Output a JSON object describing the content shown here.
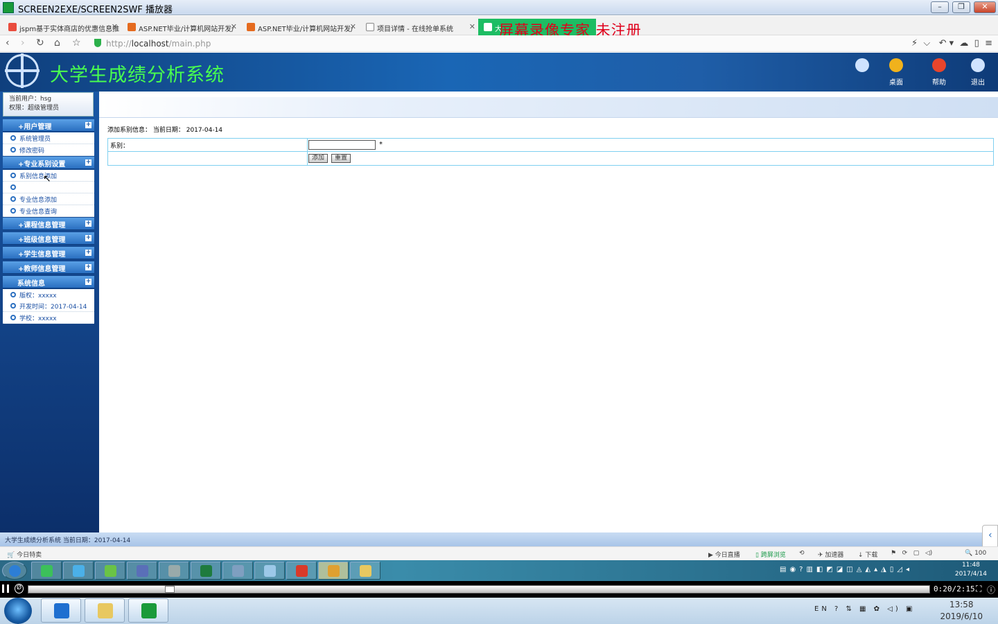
{
  "window": {
    "title": "SCREEN2EXE/SCREEN2SWF 播放器"
  },
  "tabs": [
    {
      "label": "jspm基于实体商店的优惠信息推",
      "color": "#e94c3d"
    },
    {
      "label": "ASP.NET毕业/计算机网站开发/",
      "color": "#e56b1f"
    },
    {
      "label": "ASP.NET毕业/计算机网站开发/",
      "color": "#e56b1f"
    },
    {
      "label": "项目详情 - 在线抢单系统",
      "color": "#888888"
    },
    {
      "label": "大",
      "color": "#ffffff"
    }
  ],
  "watermark": "屏幕录像专家   未注册",
  "address": {
    "scheme": "http://",
    "host": "localhost",
    "path": "/main.php"
  },
  "app": {
    "title": "大学生成绩分析系统",
    "header_buttons": [
      {
        "label": "",
        "color": "#cfe3ff"
      },
      {
        "label": "桌面",
        "color": "#f0b21c"
      },
      {
        "label": "帮助",
        "color": "#e8452c"
      },
      {
        "label": "退出",
        "color": "#cfe3ff"
      }
    ]
  },
  "user": {
    "current": "当前用户：hsg",
    "role": "权限：超级管理员"
  },
  "menu": {
    "user_mgmt": "+用户管理",
    "sys_admin": "系统管理员",
    "change_pwd": "修改密码",
    "dept_settings": "+专业系别设置",
    "dept_add": "系别信息添加",
    "major_add": "专业信息添加",
    "major_query": "专业信息查询",
    "course_mgmt": "+课程信息管理",
    "class_mgmt": "+班级信息管理",
    "student_mgmt": "+学生信息管理",
    "teacher_mgmt": "+教师信息管理",
    "sys_info": "系统信息",
    "copyright": "版权：xxxxx",
    "dev_time": "开发时间：2017-04-14",
    "school": "学校：xxxxx"
  },
  "content": {
    "crumb": "添加系别信息：  当前日期： 2017-04-14",
    "dept_label": "系别：",
    "dept_value": "",
    "required": "*",
    "add_btn": "添加",
    "reset_btn": "重置"
  },
  "footer": {
    "text": "大学生成绩分析系统 当前日期：2017-04-14"
  },
  "browser_status": {
    "today": "今日特卖",
    "live": "今日直播",
    "cast": "跨屏浏览",
    "accel": "加速器",
    "download": "下载",
    "zoom": "100"
  },
  "inner_clock": {
    "time": "11:48",
    "date": "2017/4/14"
  },
  "player": {
    "time": "0:20/2:15"
  },
  "outer_clock": {
    "time": "13:58",
    "date": "2019/6/10"
  },
  "outer_tray": {
    "lang": "EN"
  }
}
